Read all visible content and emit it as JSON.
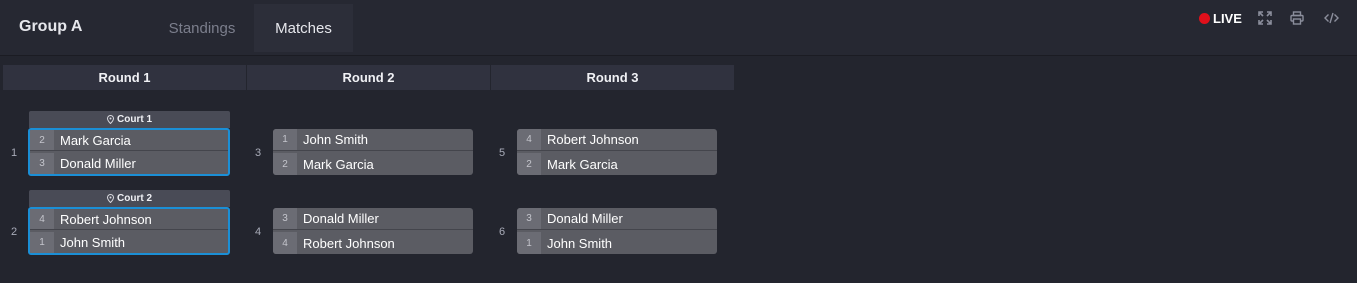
{
  "header": {
    "group_title": "Group A",
    "tabs": [
      {
        "label": "Standings",
        "active": false
      },
      {
        "label": "Matches",
        "active": true
      }
    ],
    "live_label": "LIVE",
    "icons": [
      "live-dot-icon",
      "fullscreen-icon",
      "print-icon",
      "embed-code-icon"
    ],
    "live_color": "#e0101b"
  },
  "rounds": [
    {
      "label": "Round 1"
    },
    {
      "label": "Round 2"
    },
    {
      "label": "Round 3"
    }
  ],
  "matches": [
    {
      "number": "1",
      "court": "Court 1",
      "players": [
        {
          "seed": "2",
          "name": "Mark Garcia"
        },
        {
          "seed": "3",
          "name": "Donald Miller"
        }
      ]
    },
    {
      "number": "2",
      "court": "Court 2",
      "players": [
        {
          "seed": "4",
          "name": "Robert Johnson"
        },
        {
          "seed": "1",
          "name": "John Smith"
        }
      ]
    },
    {
      "number": "3",
      "players": [
        {
          "seed": "1",
          "name": "John Smith"
        },
        {
          "seed": "2",
          "name": "Mark Garcia"
        }
      ]
    },
    {
      "number": "4",
      "players": [
        {
          "seed": "3",
          "name": "Donald Miller"
        },
        {
          "seed": "4",
          "name": "Robert Johnson"
        }
      ]
    },
    {
      "number": "5",
      "players": [
        {
          "seed": "4",
          "name": "Robert Johnson"
        },
        {
          "seed": "2",
          "name": "Mark Garcia"
        }
      ]
    },
    {
      "number": "6",
      "players": [
        {
          "seed": "3",
          "name": "Donald Miller"
        },
        {
          "seed": "1",
          "name": "John Smith"
        }
      ]
    }
  ],
  "colors": {
    "active_border": "#1b8fd6",
    "background": "#23252e"
  }
}
